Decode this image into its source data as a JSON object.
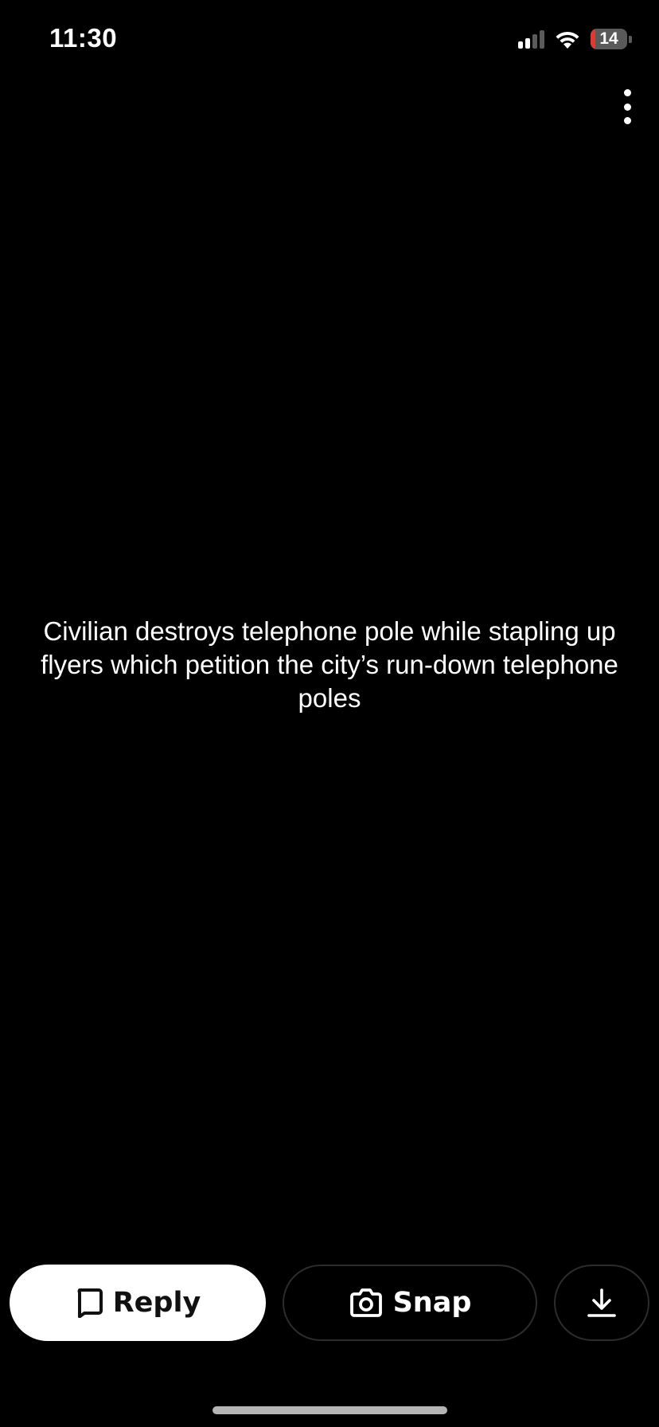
{
  "status_bar": {
    "time": "11:30",
    "battery_level": "14",
    "battery_color": "#e0392f",
    "signal_bars_active": 2,
    "signal_bars_total": 4,
    "wifi_icon": "wifi-icon",
    "signal_icon": "cellular-signal-icon"
  },
  "menu": {
    "icon": "more-vertical-icon"
  },
  "story": {
    "caption": "Civilian destroys telephone pole while stapling up flyers which petition the city’s run-down telephone poles"
  },
  "actions": {
    "reply_label": "Reply",
    "reply_icon": "chat-bubble-icon",
    "snap_label": "Snap",
    "snap_icon": "camera-icon",
    "download_icon": "download-icon"
  },
  "colors": {
    "background": "#000000",
    "text": "#ffffff",
    "reply_button_bg": "#ffffff",
    "outline": "#2c2c2c"
  }
}
